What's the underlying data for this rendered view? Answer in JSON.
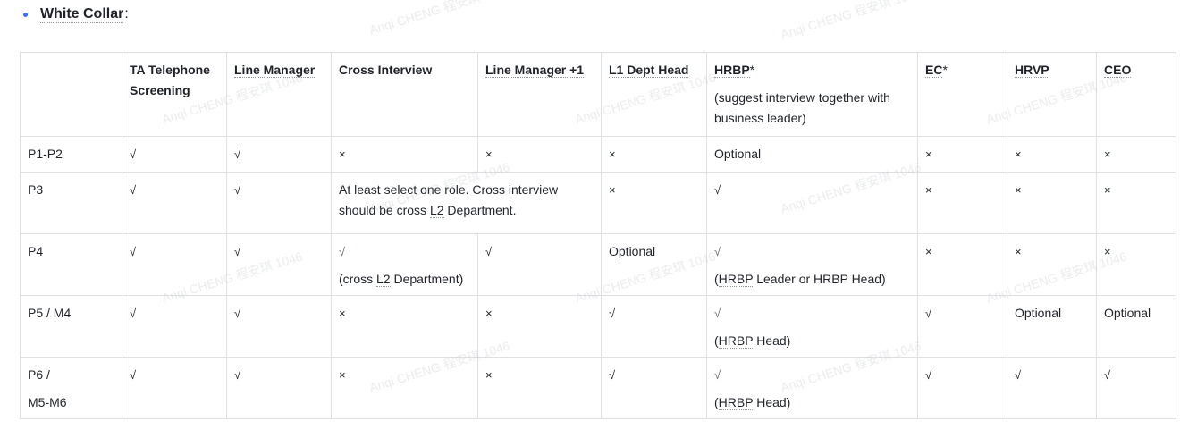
{
  "heading": {
    "bold": "White Collar",
    "suffix": ":"
  },
  "watermark": "Anqi CHENG 程安琪 1046",
  "table": {
    "header": {
      "corner": "",
      "ta_line1": "TA Telephone",
      "ta_line2": "Screening",
      "line_manager": "Line Manager",
      "cross_interview": "Cross Interview",
      "line_manager_plus": "Line Manager +1",
      "l1_dept_head": "L1 Dept Head",
      "hrbp_label": "HRBP",
      "hrbp_star": "*",
      "hrbp_note": "(suggest interview together with business leader)",
      "ec_label": "EC",
      "ec_star": "*",
      "hrvp": "HRVP",
      "ceo": "CEO"
    },
    "p12": {
      "level": "P1-P2",
      "c1": "√",
      "c2": "√",
      "c3": "×",
      "c4": "×",
      "c5": "×",
      "c6": "Optional",
      "c7": "×",
      "c8": "×",
      "c9": "×"
    },
    "p3": {
      "level": "P3",
      "c1": "√",
      "c2": "√",
      "c3_a": "At least select one role. Cross interview should be cross ",
      "c3_u": "L2",
      "c3_b": " Department.",
      "c5": "×",
      "c6": "√",
      "c7": "×",
      "c8": "×",
      "c9": "×"
    },
    "p4": {
      "level": "P4",
      "c1": "√",
      "c2": "√",
      "c3": "√",
      "c3_note_a": "(cross ",
      "c3_note_u": "L2",
      "c3_note_b": " Department)",
      "c4": "√",
      "c5": "Optional",
      "c6": "√",
      "c6_note_a": "(",
      "c6_note_u": "HRBP",
      "c6_note_b": " Leader or HRBP Head)",
      "c7": "×",
      "c8": "×",
      "c9": "×"
    },
    "p5": {
      "level": "P5 / M4",
      "c1": "√",
      "c2": "√",
      "c3": "×",
      "c4": "×",
      "c5": "√",
      "c6": "√",
      "c6_note_a": "(",
      "c6_note_u": "HRBP",
      "c6_note_b": " Head)",
      "c7": "√",
      "c8": "Optional",
      "c9": "Optional"
    },
    "p6": {
      "level_line1": "P6 /",
      "level_line2": "M5-M6",
      "c1": "√",
      "c2": "√",
      "c3": "×",
      "c4": "×",
      "c5": "√",
      "c6": "√",
      "c6_note_a": "(",
      "c6_note_u": "HRBP",
      "c6_note_b": " Head)",
      "c7": "√",
      "c8": "√",
      "c9": "√"
    }
  }
}
